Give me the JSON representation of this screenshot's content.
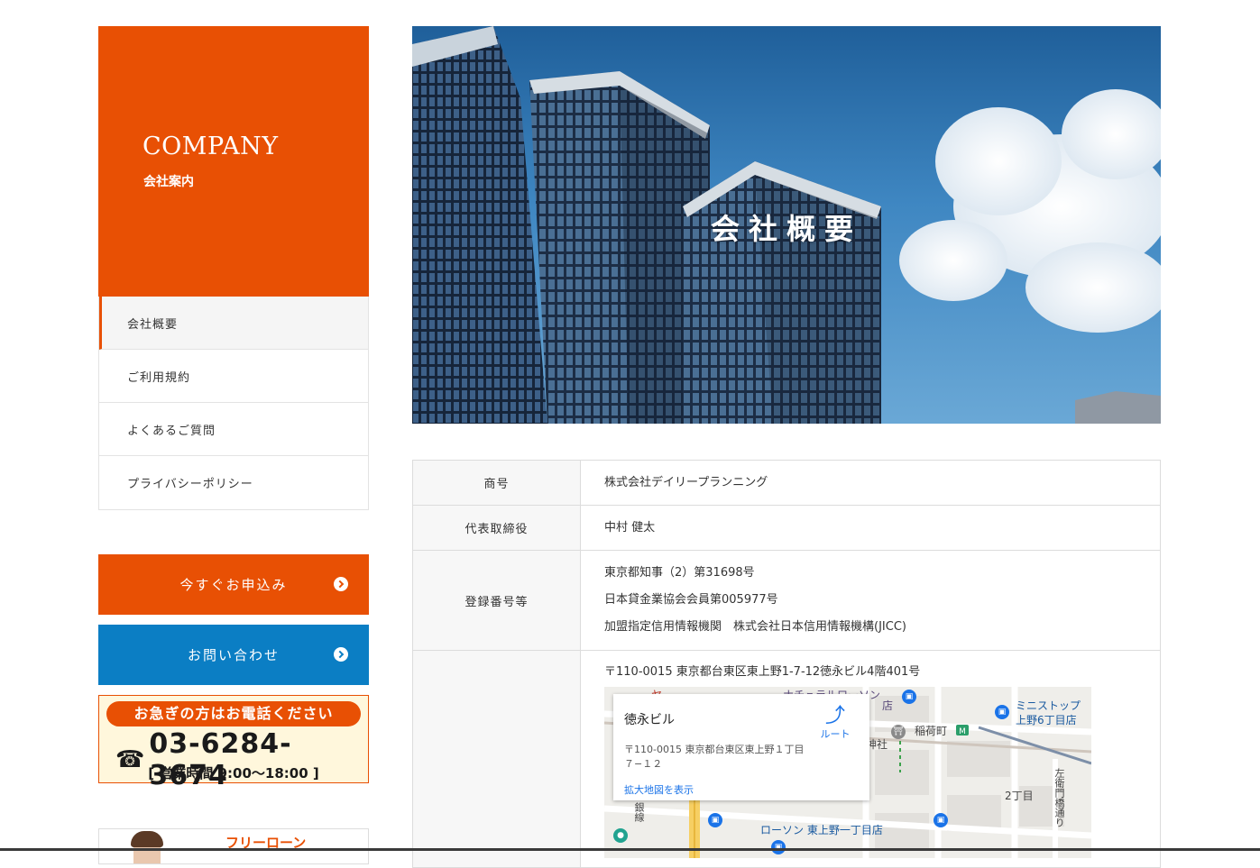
{
  "sidebar": {
    "heading_en": "COMPANY",
    "heading_jp": "会社案内",
    "nav": [
      {
        "label": "会社概要",
        "active": true
      },
      {
        "label": "ご利用規約",
        "active": false
      },
      {
        "label": "よくあるご質問",
        "active": false
      },
      {
        "label": "プライバシーポリシー",
        "active": false
      }
    ],
    "apply_button": "今すぐお申込み",
    "contact_button": "お問い合わせ",
    "phone_banner": {
      "headline": "お急ぎの方はお電話ください",
      "phone_icon": "☎",
      "phone": "03-6284-3674",
      "hours": "[ 営業時間 9:00〜18:00 ]"
    },
    "loan_banner": {
      "text": "フリーローン"
    }
  },
  "hero": {
    "title": "会社概要"
  },
  "company_info": [
    {
      "label": "商号",
      "values": [
        "株式会社デイリープランニング"
      ]
    },
    {
      "label": "代表取締役",
      "values": [
        "中村 健太"
      ]
    },
    {
      "label": "登録番号等",
      "values": [
        "東京都知事（2）第31698号",
        "日本貸金業協会会員第005977号",
        "加盟指定信用情報機関　株式会社日本信用情報機構(JICC)"
      ]
    },
    {
      "label": "",
      "values": [
        "〒110-0015 東京都台東区東上野1-7-12徳永ビル4階401号"
      ]
    }
  ],
  "map": {
    "place_name": "徳永ビル",
    "place_address": "〒110-0015 東京都台東区東上野１丁目７−１２",
    "route_label": "ルート",
    "enlarge_label": "拡大地図を表示",
    "labels": {
      "natural_lawson": "ナチュラルローソン",
      "lawson_partial": "店",
      "ministop": "ミニストップ",
      "ministop_branch": "上野6丁目店",
      "station": "稲荷町",
      "shrine": "神社",
      "chome": "2丁目",
      "lawson_bottom": "ローソン 東上野一丁目店",
      "street": "左衛門橋通り",
      "line_label": "銀線",
      "top_partial": "ヤ"
    },
    "colors": {
      "link_blue": "#1a73e8",
      "store_blue": "#1a5aa0",
      "station_red": "#c0392b"
    }
  },
  "colors": {
    "brand_orange": "#e85004",
    "contact_blue": "#0b7ec4"
  }
}
